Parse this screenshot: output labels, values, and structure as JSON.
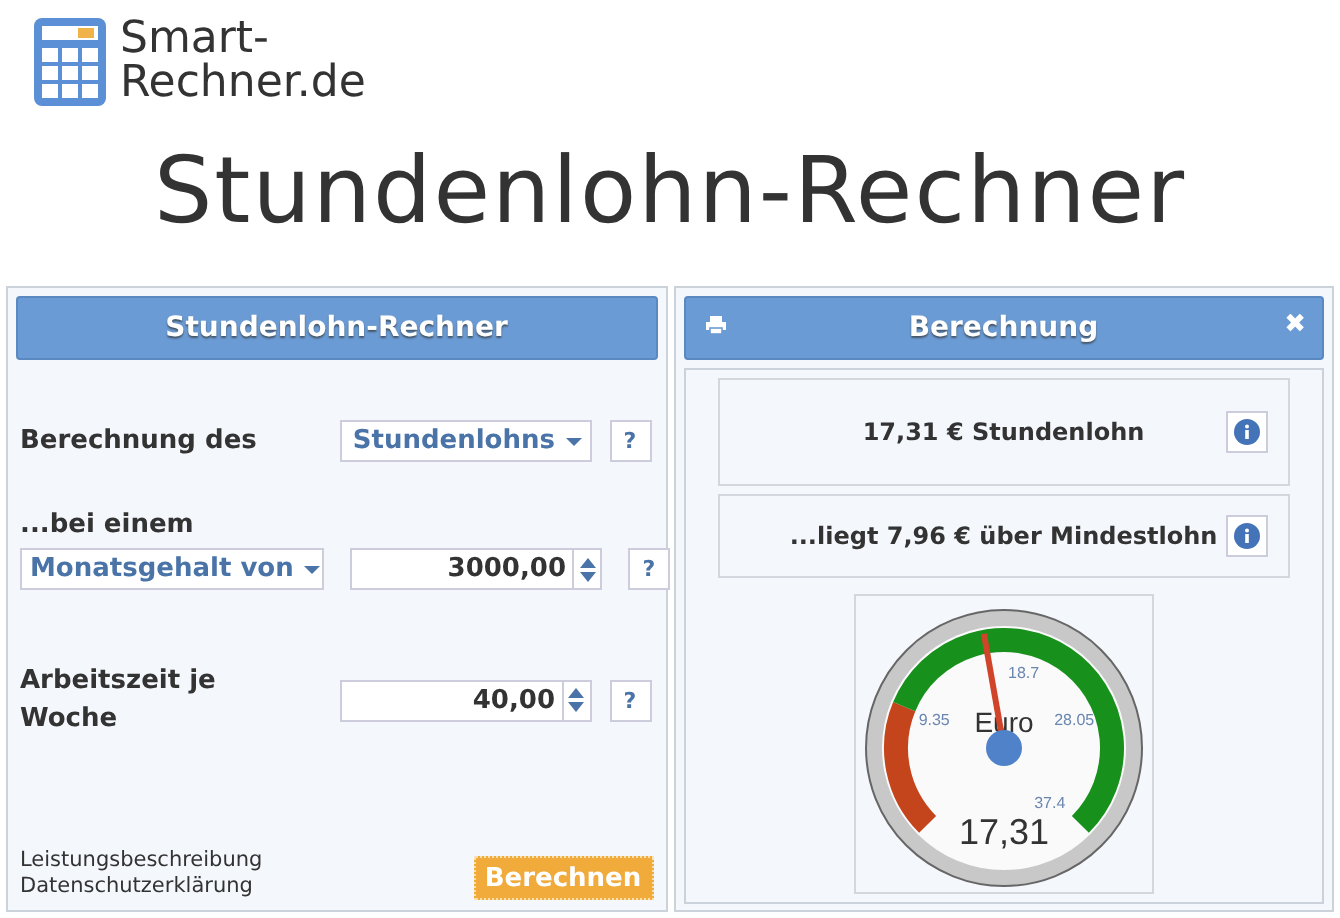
{
  "logo": {
    "lines": [
      "Smart-",
      "Rechner.de"
    ]
  },
  "page_title": "Stundenlohn-Rechner",
  "calculator": {
    "title": "Stundenlohn-Rechner",
    "rows": [
      {
        "kind": "select",
        "label": "Berechnung des",
        "value": "Stundenlohns",
        "help": "?"
      },
      {
        "kind": "select-number",
        "label": "...bei einem",
        "select": "Monatsgehalt von",
        "value": "3000,00",
        "help": "?"
      },
      {
        "kind": "number",
        "label": "Arbeitszeit je Woche",
        "value": "40,00",
        "help": "?"
      }
    ],
    "links": [
      "Leistungsbeschreibung",
      "Datenschutzerklärung"
    ],
    "button": "Berechnen"
  },
  "result": {
    "title": "Berechnung",
    "close": "✖",
    "lines": [
      "17,31 € Stundenlohn",
      "...liegt 7,96 € über Mindestlohn"
    ],
    "gauge": {
      "unit": "Euro",
      "reading": "17,31",
      "level": 0.463,
      "ticks": [
        "9.35",
        "18.7",
        "28.05",
        "37.4"
      ]
    }
  }
}
